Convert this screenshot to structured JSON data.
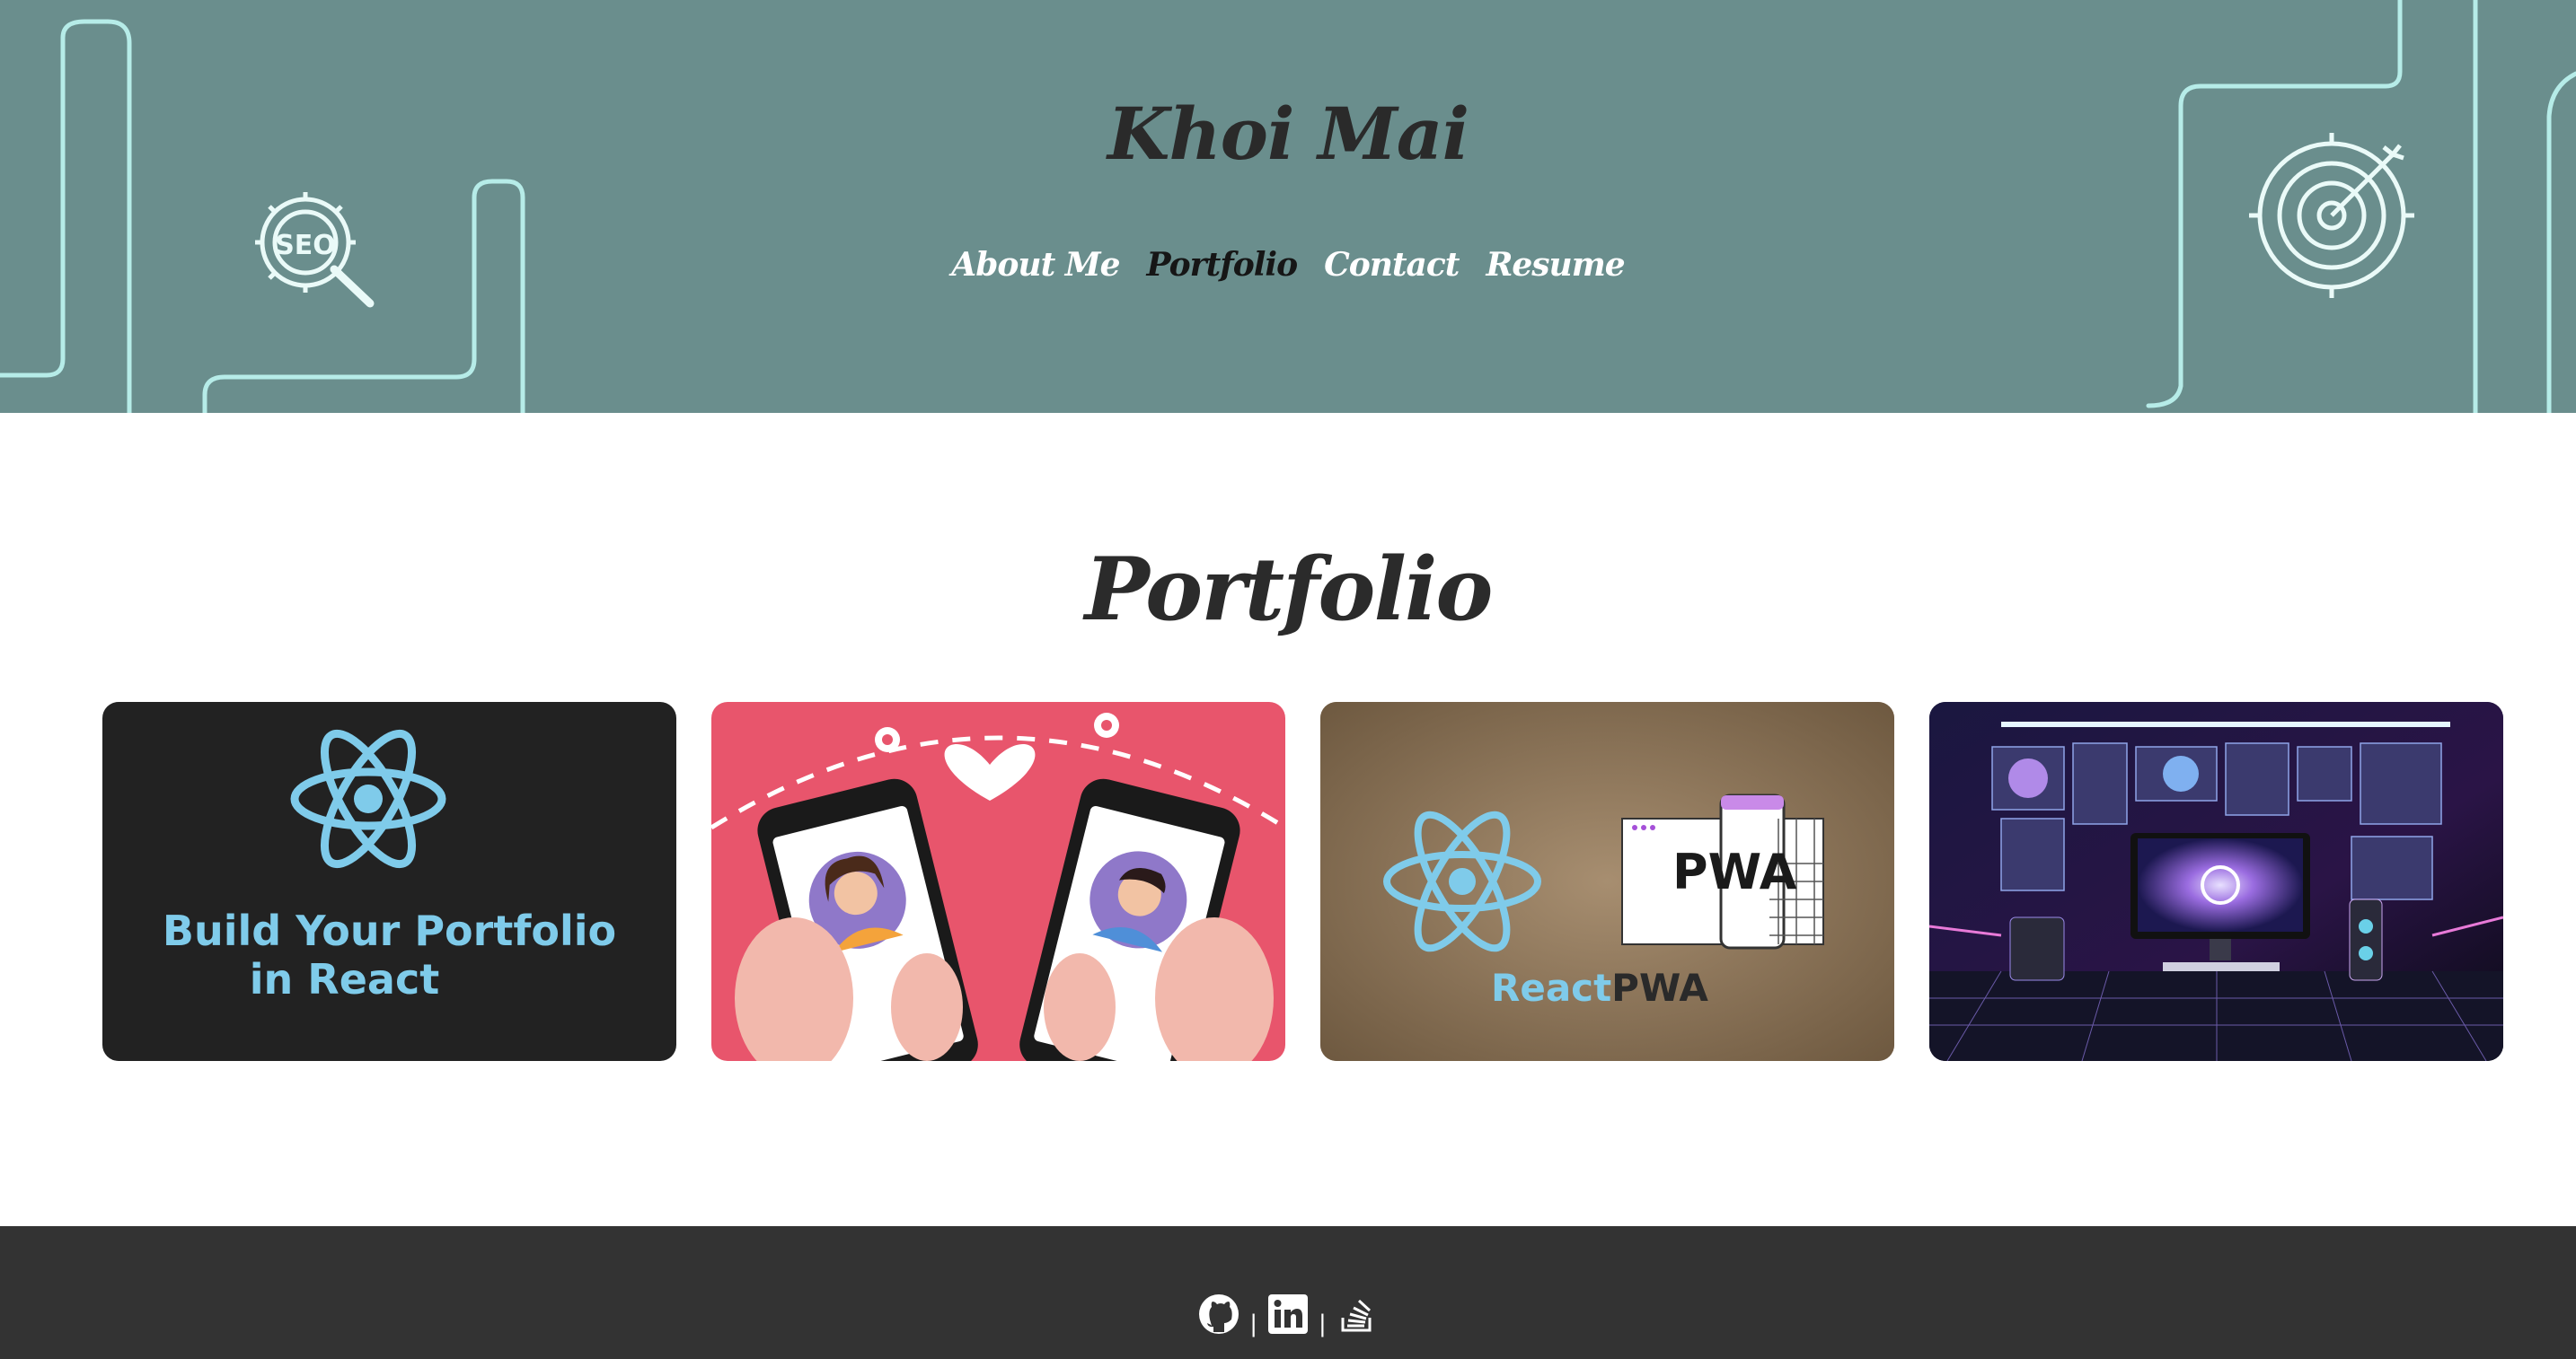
{
  "header": {
    "site_title": "Khoi Mai",
    "nav": [
      {
        "label": "About Me",
        "active": false
      },
      {
        "label": "Portfolio",
        "active": true
      },
      {
        "label": "Contact",
        "active": false
      },
      {
        "label": "Resume",
        "active": false
      }
    ],
    "decorative_icons": [
      "seo-gear-icon",
      "target-arrow-icon"
    ],
    "seo_badge_text": "SEO",
    "background_color": "#6a8e8d"
  },
  "main": {
    "section_title": "Portfolio",
    "projects": [
      {
        "image": "react-logo-card",
        "caption_line1": "Build Your Portfolio",
        "caption_line2": "in React"
      },
      {
        "image": "dating-app-phones-card"
      },
      {
        "image": "react-pwa-card",
        "pwa_text": "PWA",
        "caption_prefix": "React",
        "caption_suffix": "PWA"
      },
      {
        "image": "neon-workstation-card"
      }
    ]
  },
  "footer": {
    "social": [
      {
        "icon": "github-icon"
      },
      {
        "icon": "linkedin-icon"
      },
      {
        "icon": "stackoverflow-icon"
      }
    ],
    "separator": "|",
    "background_color": "#333333"
  },
  "colors": {
    "accent_light_blue": "#7fcbea",
    "title_dark": "#2b2b2b",
    "card_pink": "#e8556c"
  }
}
